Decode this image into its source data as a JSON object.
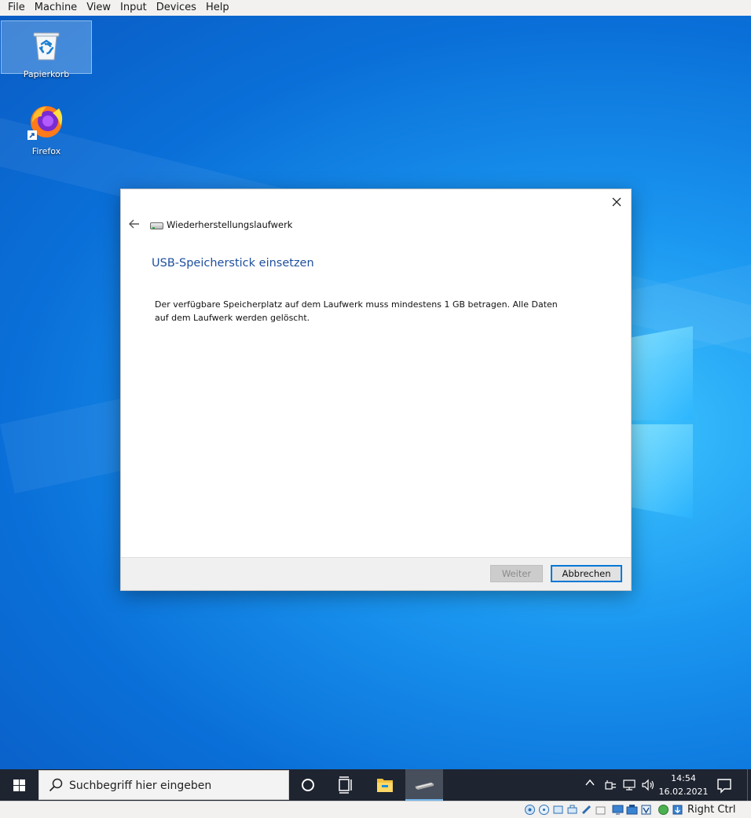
{
  "vbox_menu": [
    "File",
    "Machine",
    "View",
    "Input",
    "Devices",
    "Help"
  ],
  "desktop": {
    "icons": [
      {
        "label": "Papierkorb",
        "icon": "recycle-bin-icon"
      },
      {
        "label": "Firefox",
        "icon": "firefox-icon"
      }
    ]
  },
  "dialog": {
    "window_title": "Wiederherstellungslaufwerk",
    "heading": "USB-Speicherstick einsetzen",
    "body": "Der verfügbare Speicherplatz auf dem Laufwerk muss mindestens 1 GB betragen. Alle Daten auf dem Laufwerk werden gelöscht.",
    "next_label": "Weiter",
    "cancel_label": "Abbrechen",
    "next_enabled": false
  },
  "taskbar": {
    "search_placeholder": "Suchbegriff hier eingeben",
    "clock_time": "14:54",
    "clock_date": "16.02.2021"
  },
  "vbox_status": {
    "host_key": "Right Ctrl"
  },
  "colors": {
    "accent": "#0078d7",
    "heading": "#1c4e9e",
    "taskbar": "#1e2430"
  }
}
